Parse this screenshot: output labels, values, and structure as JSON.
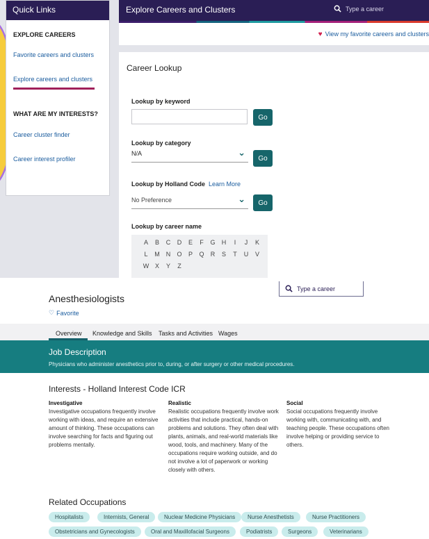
{
  "quick_links": {
    "title": "Quick Links",
    "section_explore": "EXPLORE CAREERS",
    "link_favorites": "Favorite careers and clusters",
    "link_explore": "Explore careers and clusters",
    "section_interests": "WHAT ARE MY INTERESTS?",
    "link_cluster_finder": "Career cluster finder",
    "link_interest_profiler": "Career interest profiler"
  },
  "header": {
    "title": "Explore Careers and Clusters",
    "search_placeholder": "Type a career",
    "favorites_link": "View my favorite careers and clusters"
  },
  "lookup": {
    "title": "Career Lookup",
    "keyword_label": "Lookup by keyword",
    "keyword_value": "",
    "category_label": "Lookup by category",
    "category_value": "N/A",
    "holland_label": "Lookup by Holland Code",
    "learn_more": "Learn More",
    "holland_value": "No Preference",
    "go_label": "Go",
    "name_label": "Lookup by career name",
    "letters": [
      [
        "A",
        "B",
        "C",
        "D",
        "E",
        "F",
        "G",
        "H",
        "I",
        "J",
        "K"
      ],
      [
        "L",
        "M",
        "N",
        "O",
        "P",
        "Q",
        "R",
        "S",
        "T",
        "U",
        "V"
      ],
      [
        "W",
        "X",
        "Y",
        "Z"
      ]
    ]
  },
  "occupation": {
    "title": "Anesthesiologists",
    "favorite_label": "Favorite",
    "search_placeholder": "Type a career",
    "tabs": [
      "Overview",
      "Knowledge and Skills",
      "Tasks and Activities",
      "Wages"
    ],
    "job_description_title": "Job Description",
    "job_description": "Physicians who administer anesthetics prior to, during, or after surgery or other medical procedures.",
    "interests_title": "Interests - Holland Interest Code ICR",
    "interests": [
      {
        "name": "Investigative",
        "text": "Investigative occupations frequently involve working with ideas, and require an extensive amount of thinking. These occupations can involve searching for facts and figuring out problems mentally."
      },
      {
        "name": "Realistic",
        "text": "Realistic occupations frequently involve work activities that include practical, hands-on problems and solutions. They often deal with plants, animals, and real-world materials like wood, tools, and machinery. Many of the occupations require working outside, and do not involve a lot of paperwork or working closely with others."
      },
      {
        "name": "Social",
        "text": "Social occupations frequently involve working with, communicating with, and teaching people. These occupations often involve helping or providing service to others."
      }
    ],
    "related_title": "Related Occupations",
    "related_row1": [
      "Hospitalists",
      "Internists, General",
      "Nuclear Medicine Physicians",
      "Nurse Anesthetists",
      "Nurse Practitioners"
    ],
    "related_row2": [
      "Obstetricians and Gynecologists",
      "Oral and Maxillofacial Surgeons",
      "Podiatrists",
      "Surgeons",
      "Veterinarians"
    ]
  },
  "colors": {
    "header_bg": "#2a1e55",
    "teal": "#167d80",
    "go_button": "#16656a",
    "link": "#1a5c9e",
    "active_underline": "#a0205a",
    "chip_bg": "#c9ecec"
  },
  "icons": {
    "search": "magnifier-icon",
    "heart_filled": "heart-filled-icon",
    "heart_outline": "heart-outline-icon",
    "chevron": "chevron-down-icon"
  }
}
